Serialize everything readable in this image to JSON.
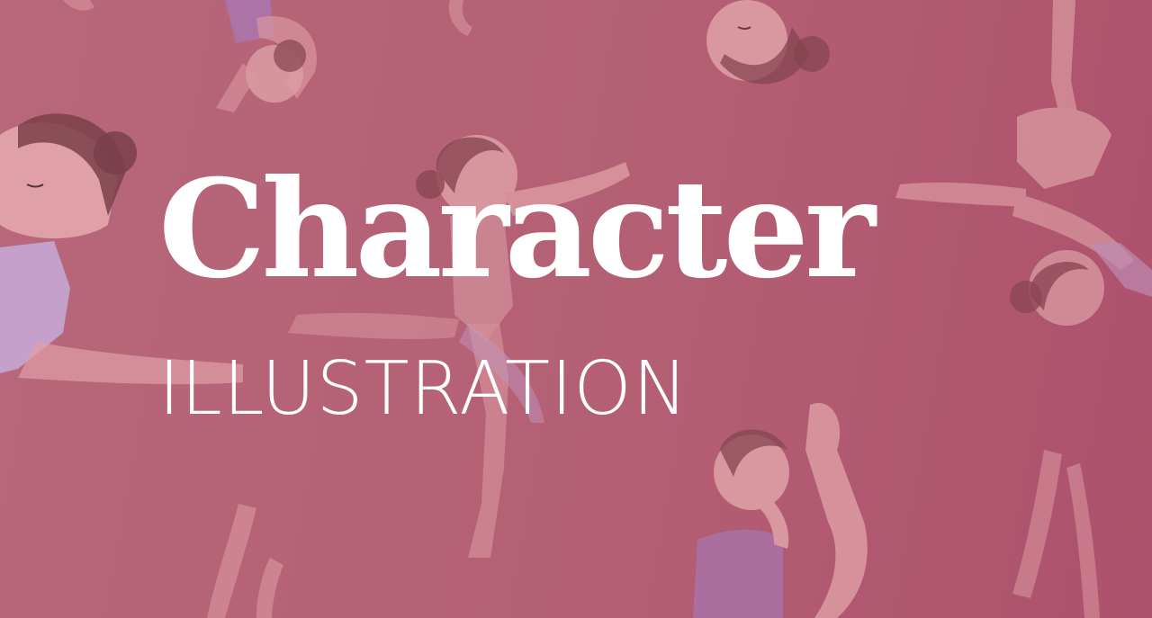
{
  "banner": {
    "title": "Character",
    "subtitle": "ILLUSTRATION"
  },
  "illustration": {
    "subject": "ballerina-dancers",
    "colors": {
      "background": "#b4627a",
      "skin": "#e0a0a6",
      "hair": "#7a3f4a",
      "leotard_lilac": "#c6aad8",
      "leotard_violet": "#a878b4",
      "text": "#ffffff"
    }
  }
}
